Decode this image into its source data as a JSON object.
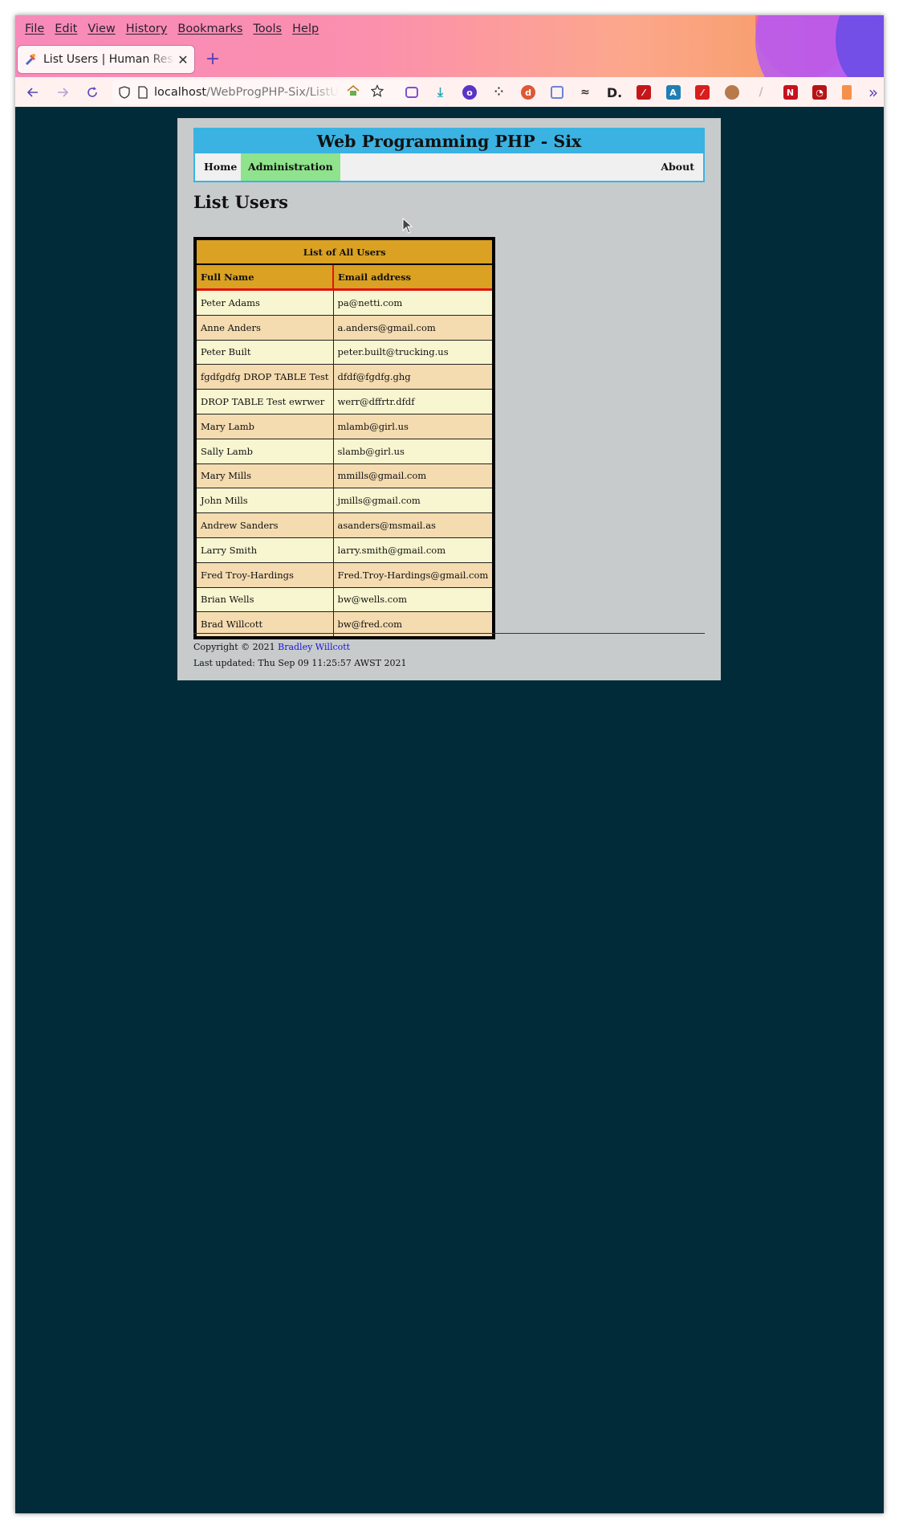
{
  "browser": {
    "menu": [
      "File",
      "Edit",
      "View",
      "History",
      "Bookmarks",
      "Tools",
      "Help"
    ],
    "tab_title": "List Users | Human Resources",
    "tab_close": "✕",
    "new_tab": "+",
    "url_host": "localhost",
    "url_path": "/WebProgPHP-Six/ListUsers.php",
    "extensions": [
      "pocket-icon",
      "download-icon",
      "privacy-icon",
      "dots-icon",
      "duckduckgo-icon",
      "containers-icon",
      "shoe-icon",
      "d-icon",
      "pdf-icon",
      "a-icon",
      "acrobat-icon",
      "cookie-icon",
      "feather-icon",
      "n-icon",
      "rss-icon",
      "trash-icon"
    ],
    "overflow": "»"
  },
  "site": {
    "title": "Web Programming PHP - Six",
    "nav": {
      "home": "Home",
      "admin": "Administration",
      "about": "About"
    }
  },
  "page": {
    "heading": "List Users",
    "table": {
      "caption": "List of All Users",
      "headers": [
        "Full Name",
        "Email address"
      ],
      "rows": [
        [
          "Peter Adams",
          "pa@netti.com"
        ],
        [
          "Anne Anders",
          "a.anders@gmail.com"
        ],
        [
          "Peter Built",
          "peter.built@trucking.us"
        ],
        [
          "fgdfgdfg DROP TABLE Test",
          "dfdf@fgdfg.ghg"
        ],
        [
          "DROP TABLE Test ewrwer",
          "werr@dffrtr.dfdf"
        ],
        [
          "Mary Lamb",
          "mlamb@girl.us"
        ],
        [
          "Sally Lamb",
          "slamb@girl.us"
        ],
        [
          "Mary Mills",
          "mmills@gmail.com"
        ],
        [
          "John Mills",
          "jmills@gmail.com"
        ],
        [
          "Andrew Sanders",
          "asanders@msmail.as"
        ],
        [
          "Larry Smith",
          "larry.smith@gmail.com"
        ],
        [
          "Fred Troy-Hardings",
          "Fred.Troy-Hardings@gmail.com"
        ],
        [
          "Brian Wells",
          "bw@wells.com"
        ],
        [
          "Brad Willcott",
          "bw@fred.com"
        ]
      ]
    }
  },
  "footer": {
    "copyright_prefix": "Copyright © 2021",
    "author_link": "Bradley Willcott",
    "last_updated": "Last updated: Thu Sep 09 11:25:57 AWST 2021"
  },
  "colors": {
    "header_blue": "#3ab3e3",
    "admin_green": "#8ee38c",
    "table_gold": "#daa122",
    "row_light": "#f8f6d0",
    "row_dark": "#f4dbb0",
    "desktop_bg": "#022b3a",
    "page_bg": "#c8cbcc"
  }
}
